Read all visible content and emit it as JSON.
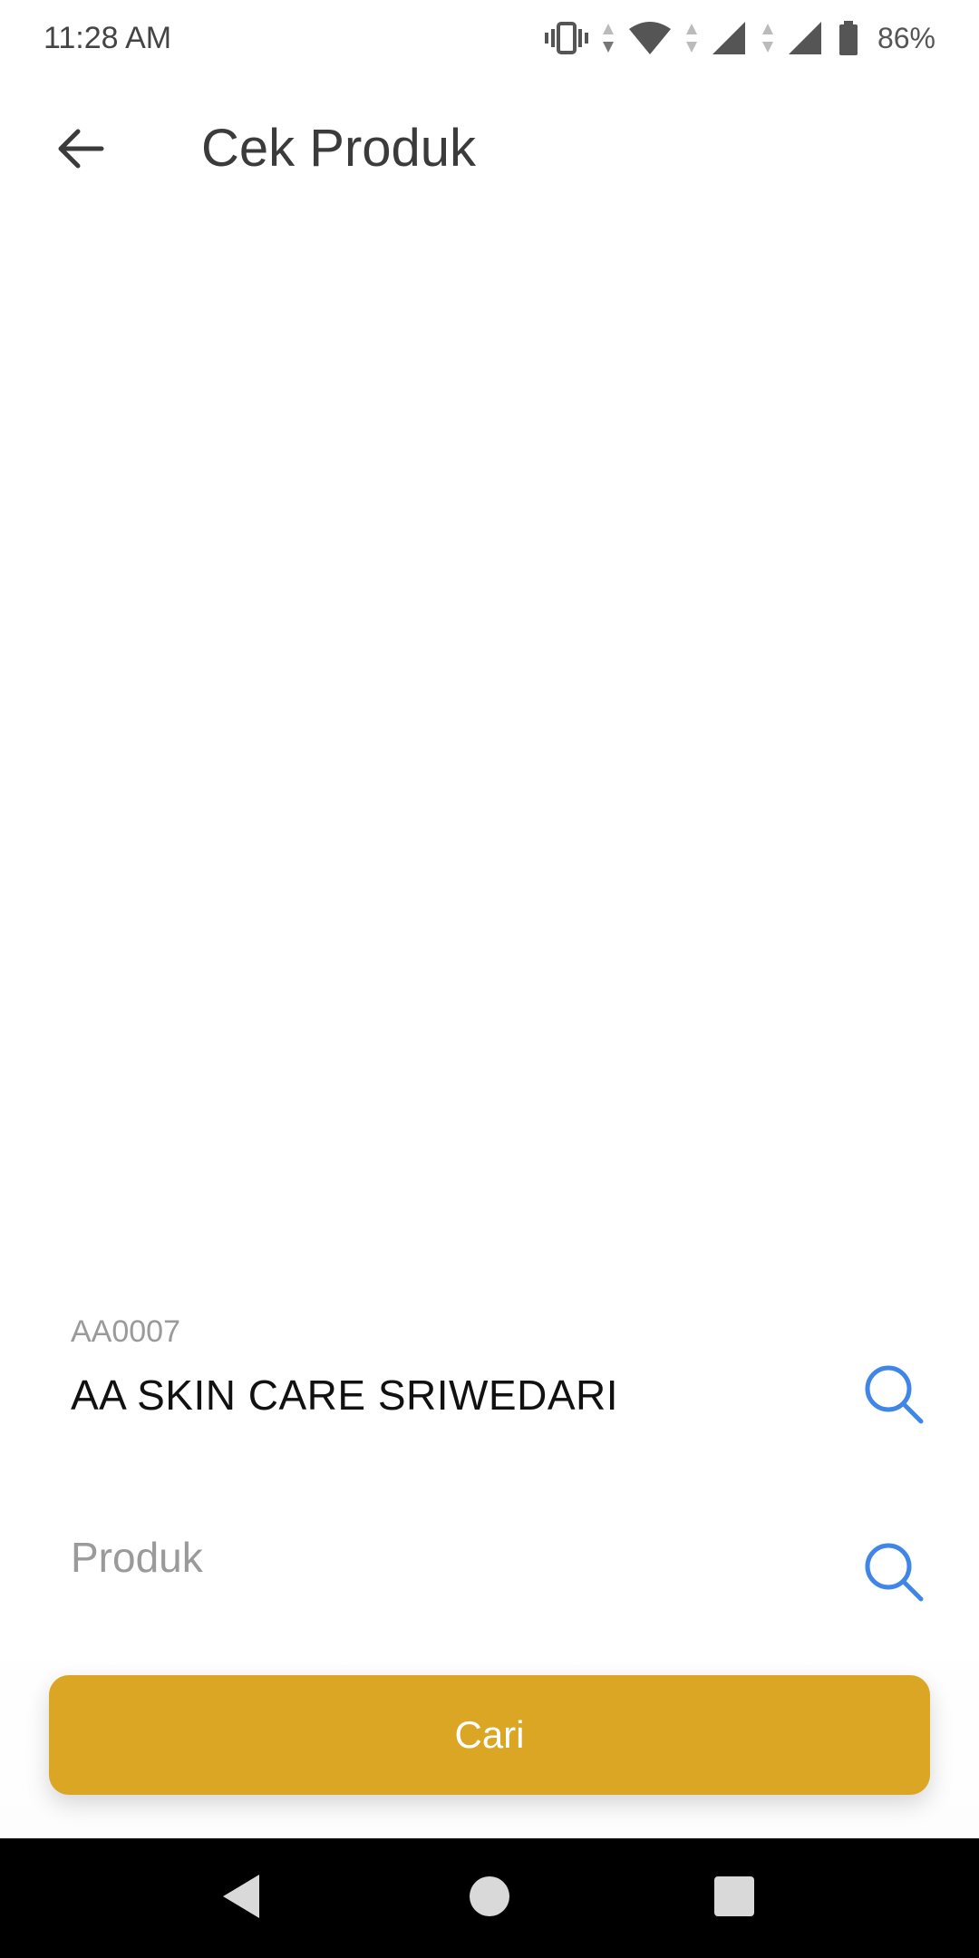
{
  "status_bar": {
    "time": "11:28 AM",
    "battery_percent": "86%",
    "icons": [
      "vibrate-icon",
      "data-arrows-icon",
      "wifi-icon",
      "signal-1-icon",
      "signal-2-icon",
      "battery-icon"
    ]
  },
  "app_bar": {
    "back_icon": "arrow-left-icon",
    "title": "Cek Produk"
  },
  "form": {
    "store": {
      "code": "AA0007",
      "name": "AA SKIN CARE SRIWEDARI",
      "search_icon": "search-icon"
    },
    "product": {
      "value": "",
      "placeholder": "Produk",
      "search_icon": "search-icon"
    }
  },
  "actions": {
    "search_label": "Cari"
  },
  "colors": {
    "accent": "#DAA623",
    "icon_blue": "#3F86E8",
    "title": "#3B3B3B",
    "placeholder": "#9A9A9A"
  },
  "nav_bar": {
    "buttons": [
      "back-nav-icon",
      "home-nav-icon",
      "recents-nav-icon"
    ]
  }
}
